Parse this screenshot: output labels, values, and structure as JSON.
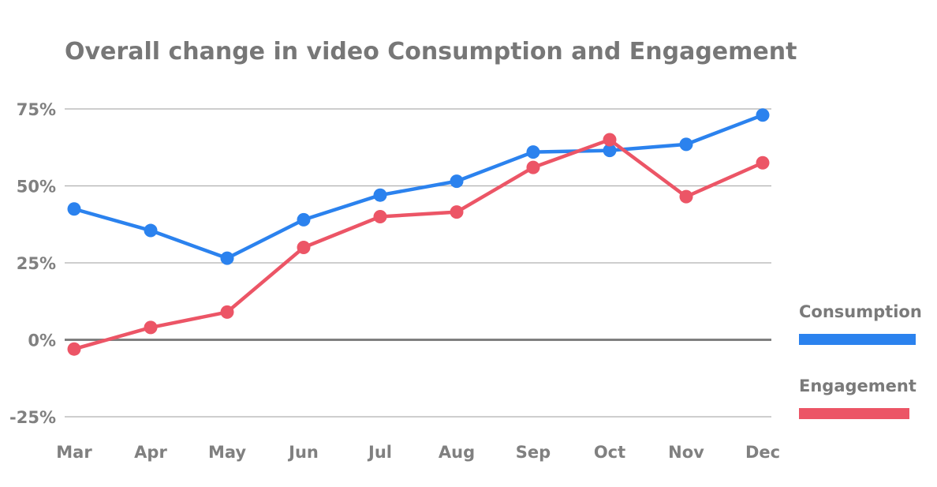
{
  "chart_data": {
    "type": "line",
    "title": "Overall change in video Consumption and Engagement",
    "xlabel": "",
    "ylabel": "",
    "categories": [
      "Mar",
      "Apr",
      "May",
      "Jun",
      "Jul",
      "Aug",
      "Sep",
      "Oct",
      "Nov",
      "Dec"
    ],
    "ylim": [
      -25,
      75
    ],
    "yticks": [
      75,
      50,
      25,
      0,
      -25
    ],
    "ytick_labels": [
      "75%",
      "50%",
      "25%",
      "0%",
      "-25%"
    ],
    "grid": true,
    "legend_position": "right",
    "series": [
      {
        "name": "Consumption",
        "color": "#2b82ee",
        "values": [
          42.5,
          35.5,
          26.5,
          39,
          47,
          51.5,
          61,
          61.5,
          63.5,
          73
        ]
      },
      {
        "name": "Engagement",
        "color": "#ec5566",
        "values": [
          -3,
          4,
          9,
          30,
          40,
          41.5,
          56,
          65,
          46.5,
          57.5
        ]
      }
    ]
  }
}
